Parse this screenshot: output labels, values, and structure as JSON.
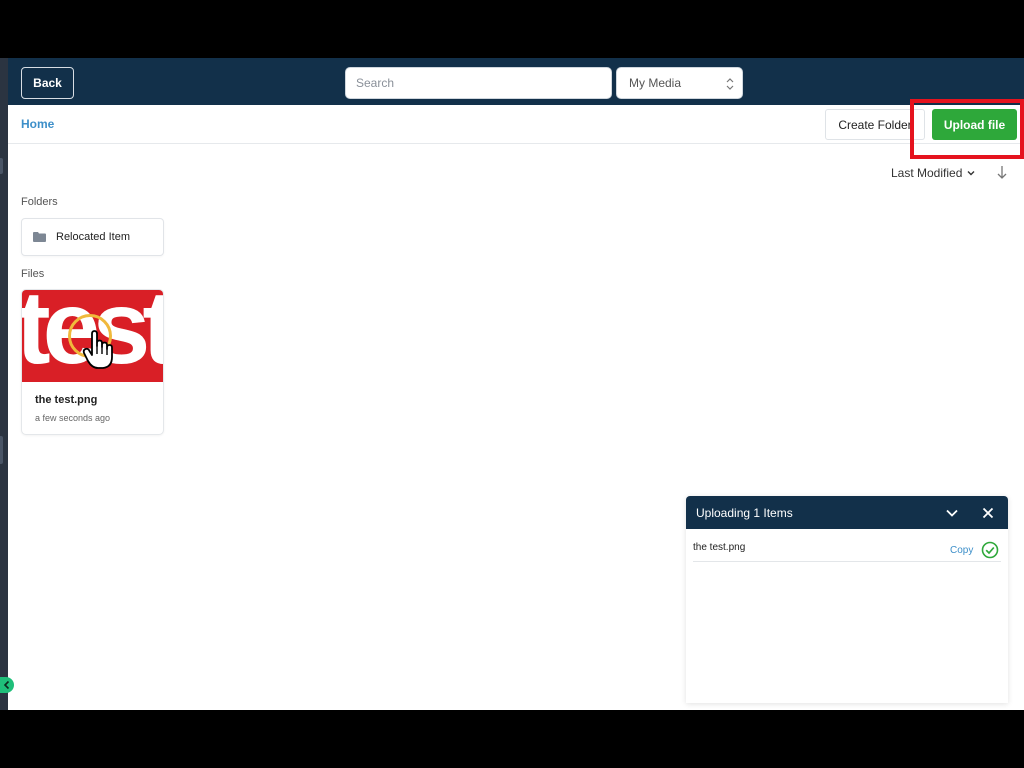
{
  "header": {
    "back_label": "Back",
    "search_placeholder": "Search",
    "media_select": "My Media"
  },
  "toolbar": {
    "breadcrumb_home": "Home",
    "create_folder_label": "Create Folder",
    "upload_label": "Upload file"
  },
  "sort": {
    "label": "Last Modified"
  },
  "folders": {
    "section_label": "Folders",
    "items": [
      {
        "name": "Relocated Item"
      }
    ]
  },
  "files": {
    "section_label": "Files",
    "items": [
      {
        "name": "the test.png",
        "modified": "a few seconds ago",
        "thumbnail_text": "test"
      }
    ]
  },
  "upload_panel": {
    "title": "Uploading 1 Items",
    "items": [
      {
        "name": "the test.png",
        "action": "Copy",
        "status": "complete"
      }
    ]
  },
  "colors": {
    "header_bg": "#12304a",
    "accent_link": "#3d8fc9",
    "upload_green": "#2ea83a",
    "highlight_red": "#e5131e",
    "thumb_red": "#d91f26"
  }
}
